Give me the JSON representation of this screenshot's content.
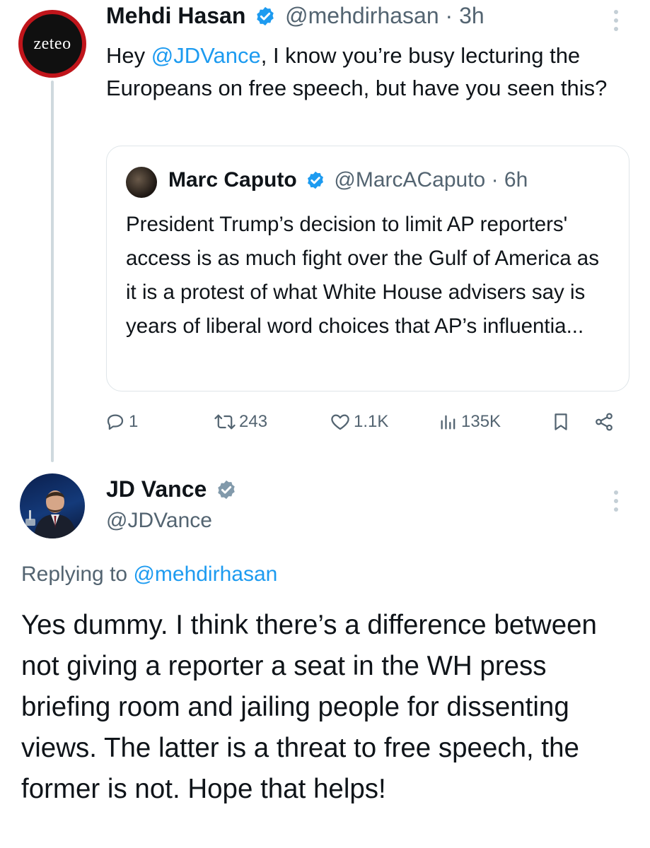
{
  "tweet": {
    "avatar_text": "zeteo",
    "author_name": "Mehdi Hasan",
    "author_handle": "@mehdirhasan",
    "separator": " · ",
    "time": "3h",
    "text_before": "Hey ",
    "mention": "@JDVance",
    "text_after": ", I know you’re busy lecturing the Europeans on free speech, but have you seen this?",
    "quote": {
      "author_name": "Marc Caputo",
      "author_handle": "@MarcACaputo",
      "time": "6h",
      "text": "President Trump’s decision to limit AP reporters' access is as much fight over the Gulf of America as it is a protest of what White House advisers say is years of liberal word choices that AP’s influentia..."
    },
    "stats": {
      "replies": "1",
      "reposts": "243",
      "likes": "1.1K",
      "views": "135K"
    }
  },
  "reply": {
    "author_name": "JD Vance",
    "author_handle": "@JDVance",
    "replying_prefix": "Replying to ",
    "replying_to": "@mehdirhasan",
    "text": "Yes dummy. I think there’s a difference between not giving a reporter a seat in the WH press briefing room and jailing people for dissenting views. The latter is a threat to free speech, the former is not. Hope that helps!"
  },
  "colors": {
    "accent": "#1d9bf0",
    "secondary_text": "#536471",
    "gray_badge": "#829aab",
    "zeteo_red": "#c0151b"
  }
}
